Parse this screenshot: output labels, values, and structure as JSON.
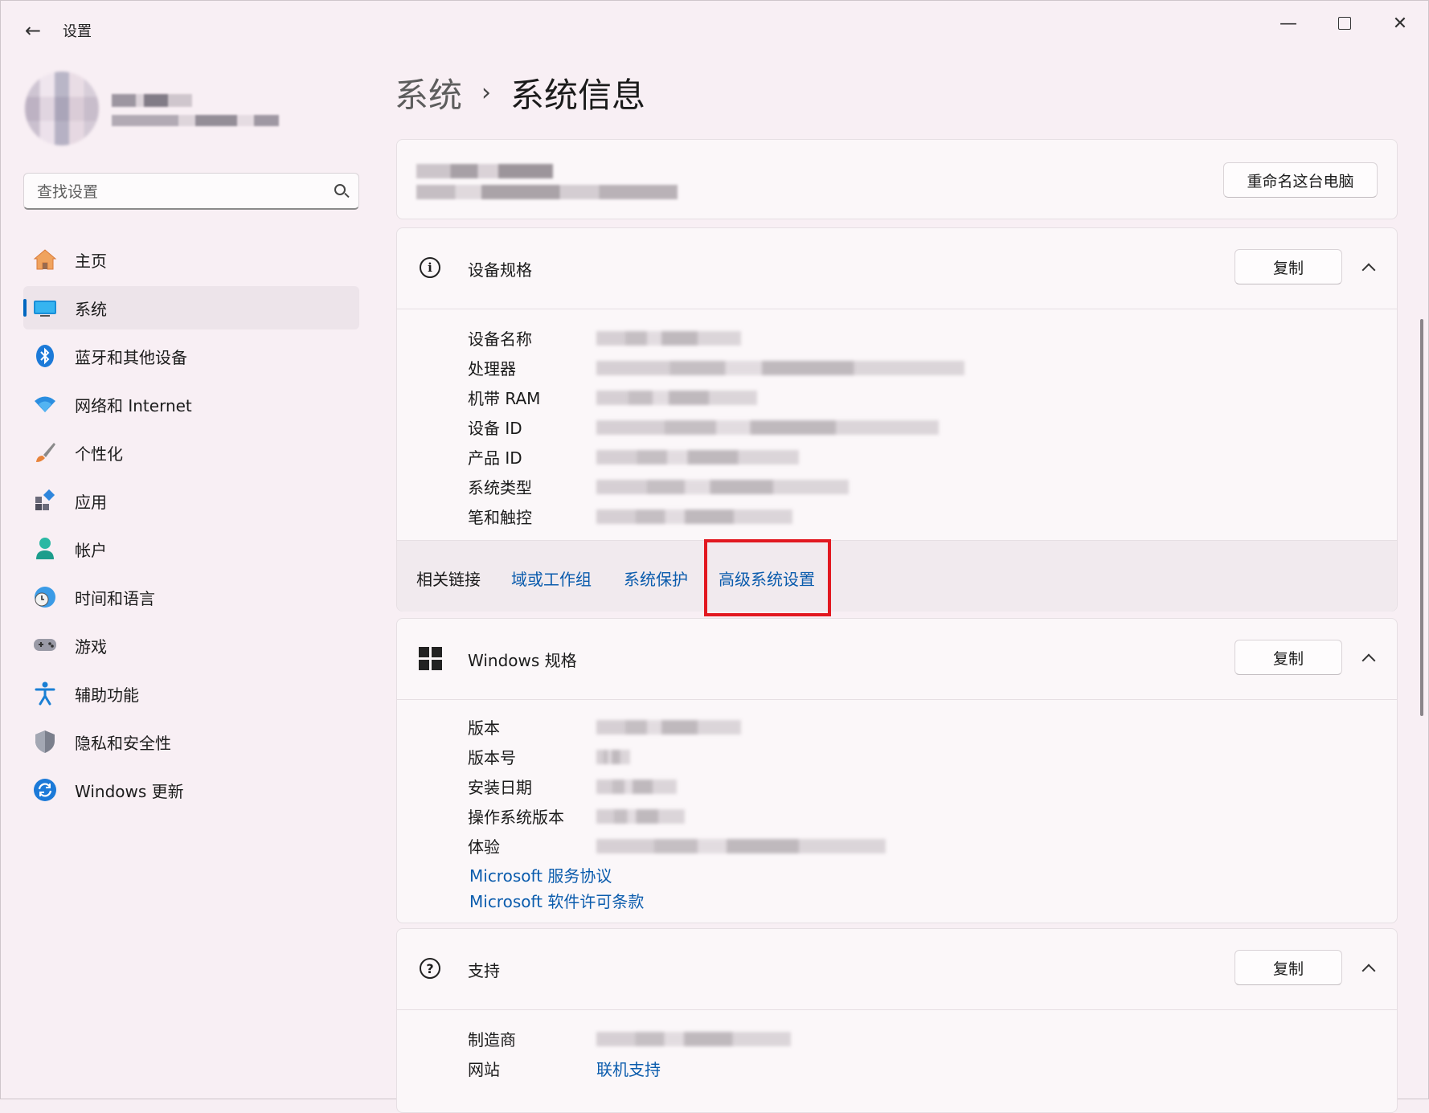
{
  "window": {
    "title": "设置",
    "back_icon": "←",
    "minimize_icon": "—",
    "close_icon": "✕"
  },
  "search": {
    "placeholder": "查找设置"
  },
  "sidebar": {
    "items": [
      {
        "label": "主页",
        "icon": "home-icon",
        "active": false
      },
      {
        "label": "系统",
        "icon": "monitor-icon",
        "active": true
      },
      {
        "label": "蓝牙和其他设备",
        "icon": "bluetooth-icon",
        "active": false
      },
      {
        "label": "网络和 Internet",
        "icon": "wifi-icon",
        "active": false
      },
      {
        "label": "个性化",
        "icon": "brush-icon",
        "active": false
      },
      {
        "label": "应用",
        "icon": "apps-icon",
        "active": false
      },
      {
        "label": "帐户",
        "icon": "person-icon",
        "active": false
      },
      {
        "label": "时间和语言",
        "icon": "globe-clock-icon",
        "active": false
      },
      {
        "label": "游戏",
        "icon": "gamepad-icon",
        "active": false
      },
      {
        "label": "辅助功能",
        "icon": "accessibility-icon",
        "active": false
      },
      {
        "label": "隐私和安全性",
        "icon": "shield-icon",
        "active": false
      },
      {
        "label": "Windows 更新",
        "icon": "sync-icon",
        "active": false
      }
    ]
  },
  "breadcrumb": {
    "parent": "系统",
    "separator": "›",
    "current": "系统信息"
  },
  "pc_card": {
    "rename_label": "重命名这台电脑"
  },
  "device_specs": {
    "title": "设备规格",
    "copy_label": "复制",
    "rows": [
      {
        "label": "设备名称"
      },
      {
        "label": "处理器"
      },
      {
        "label": "机带 RAM"
      },
      {
        "label": "设备 ID"
      },
      {
        "label": "产品 ID"
      },
      {
        "label": "系统类型"
      },
      {
        "label": "笔和触控"
      }
    ],
    "related_label": "相关链接",
    "related_links": [
      "域或工作组",
      "系统保护",
      "高级系统设置"
    ]
  },
  "windows_specs": {
    "title": "Windows 规格",
    "copy_label": "复制",
    "rows": [
      {
        "label": "版本"
      },
      {
        "label": "版本号"
      },
      {
        "label": "安装日期"
      },
      {
        "label": "操作系统版本"
      },
      {
        "label": "体验"
      }
    ],
    "links": [
      "Microsoft 服务协议",
      "Microsoft 软件许可条款"
    ]
  },
  "support": {
    "title": "支持",
    "copy_label": "复制",
    "rows": [
      {
        "label": "制造商"
      },
      {
        "label": "网站",
        "link": "联机支持"
      }
    ]
  },
  "colors": {
    "accent": "#0067c0",
    "link": "#0b5cad",
    "highlight_box": "#e21820"
  }
}
